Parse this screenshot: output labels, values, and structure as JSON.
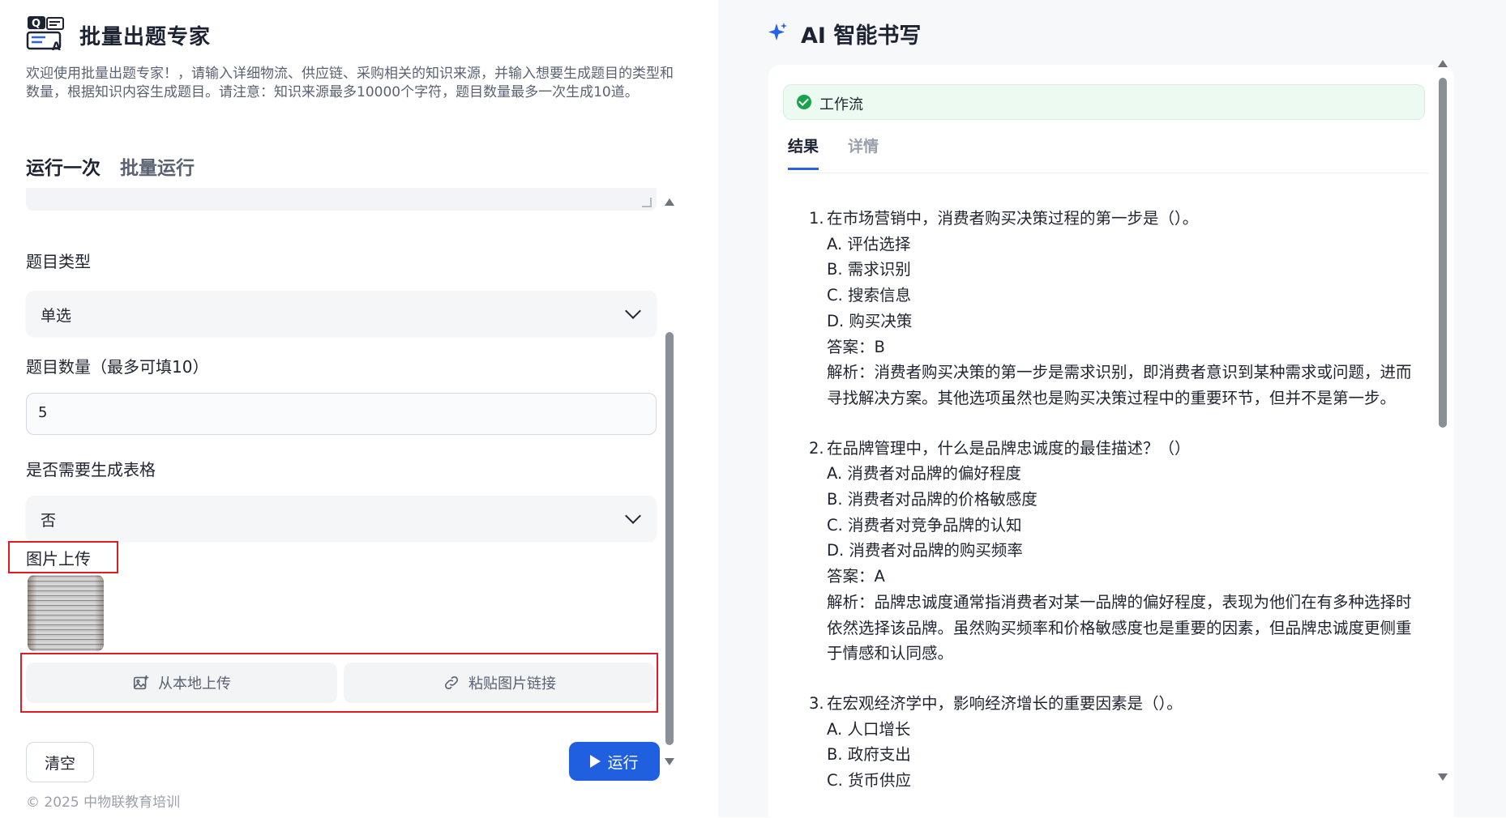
{
  "left": {
    "app_title": "批量出题专家",
    "description": "欢迎使用批量出题专家！，请输入详细物流、供应链、采购相关的知识来源，并输入想要生成题目的类型和数量，根据知识内容生成题目。请注意：知识来源最多10000个字符，题目数量最多一次生成10道。",
    "tabs": [
      {
        "label": "运行一次",
        "active": true
      },
      {
        "label": "批量运行",
        "active": false
      }
    ],
    "fields": {
      "question_type": {
        "label": "题目类型",
        "value": "单选"
      },
      "question_count": {
        "label": "题目数量（最多可填10）",
        "value": "5"
      },
      "need_table": {
        "label": "是否需要生成表格",
        "value": "否"
      },
      "image_upload": {
        "label": "图片上传"
      }
    },
    "upload": {
      "local_label": "从本地上传",
      "link_label": "粘贴图片链接"
    },
    "buttons": {
      "clear": "清空",
      "run": "运行"
    },
    "copyright": "© 2025 中物联教育培训",
    "colors": {
      "accent": "#1f5fe0",
      "highlight": "#e01b24"
    }
  },
  "right": {
    "title": "AI 智能书写",
    "workflow_label": "工作流",
    "tabs": [
      {
        "label": "结果",
        "active": true
      },
      {
        "label": "详情",
        "active": false
      }
    ],
    "questions": [
      {
        "num": "1.",
        "title": "在市场营销中，消费者购买决策过程的第一步是（）。",
        "options": [
          "A. 评估选择",
          "B. 需求识别",
          "C. 搜索信息",
          "D. 购买决策"
        ],
        "answer": "答案：B",
        "analysis": "解析：消费者购买决策的第一步是需求识别，即消费者意识到某种需求或问题，进而寻找解决方案。其他选项虽然也是购买决策过程中的重要环节，但并不是第一步。"
      },
      {
        "num": "2.",
        "title": "在品牌管理中，什么是品牌忠诚度的最佳描述？（）",
        "options": [
          "A. 消费者对品牌的偏好程度",
          "B. 消费者对品牌的价格敏感度",
          "C. 消费者对竞争品牌的认知",
          "D. 消费者对品牌的购买频率"
        ],
        "answer": "答案：A",
        "analysis": "解析：品牌忠诚度通常指消费者对某一品牌的偏好程度，表现为他们在有多种选择时依然选择该品牌。虽然购买频率和价格敏感度也是重要的因素，但品牌忠诚度更侧重于情感和认同感。"
      },
      {
        "num": "3.",
        "title": "在宏观经济学中，影响经济增长的重要因素是（）。",
        "options": [
          "A. 人口增长",
          "B. 政府支出",
          "C. 货币供应"
        ],
        "answer": "",
        "analysis": ""
      }
    ]
  }
}
